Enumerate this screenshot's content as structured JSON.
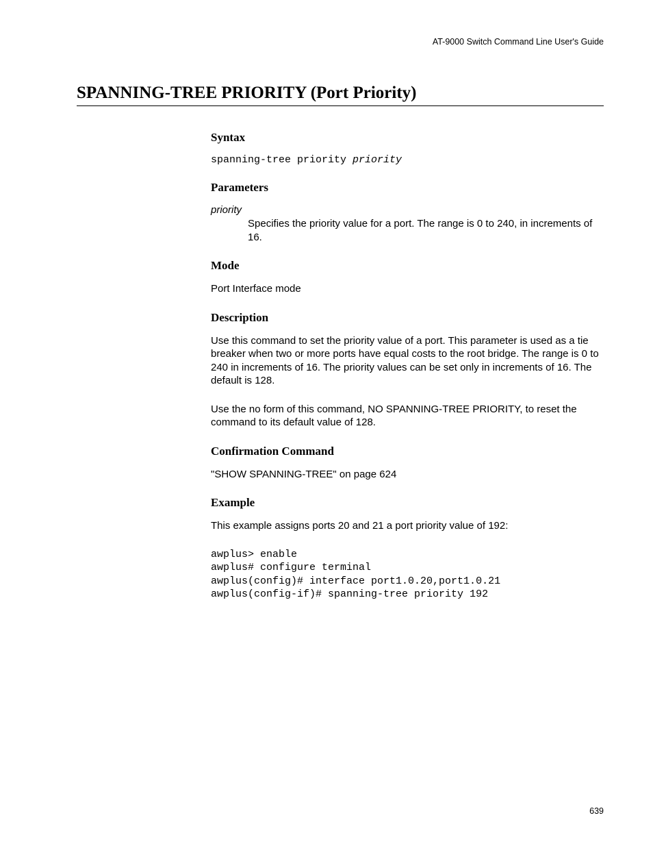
{
  "header": "AT-9000 Switch Command Line User's Guide",
  "title": "SPANNING-TREE PRIORITY (Port Priority)",
  "sections": {
    "syntax": {
      "heading": "Syntax",
      "cmd": "spanning-tree priority ",
      "arg": "priority"
    },
    "parameters": {
      "heading": "Parameters",
      "param_name": "priority",
      "param_desc": "Specifies the priority value for a port. The range is 0 to 240, in increments of 16."
    },
    "mode": {
      "heading": "Mode",
      "text": "Port Interface mode"
    },
    "description": {
      "heading": "Description",
      "p1": "Use this command to set the priority value of a port. This parameter is used as a tie breaker when two or more ports have equal costs to the root bridge. The range is 0 to 240 in increments of 16. The priority values can be set only in increments of 16. The default is 128.",
      "p2": "Use the no form of this command, NO SPANNING-TREE PRIORITY, to reset the command to its default value of 128."
    },
    "confirmation": {
      "heading": "Confirmation Command",
      "text": "\"SHOW SPANNING-TREE\" on page 624"
    },
    "example": {
      "heading": "Example",
      "intro": "This example assigns ports 20 and 21 a port priority value of 192:",
      "code": "awplus> enable\nawplus# configure terminal\nawplus(config)# interface port1.0.20,port1.0.21\nawplus(config-if)# spanning-tree priority 192"
    }
  },
  "page_number": "639"
}
